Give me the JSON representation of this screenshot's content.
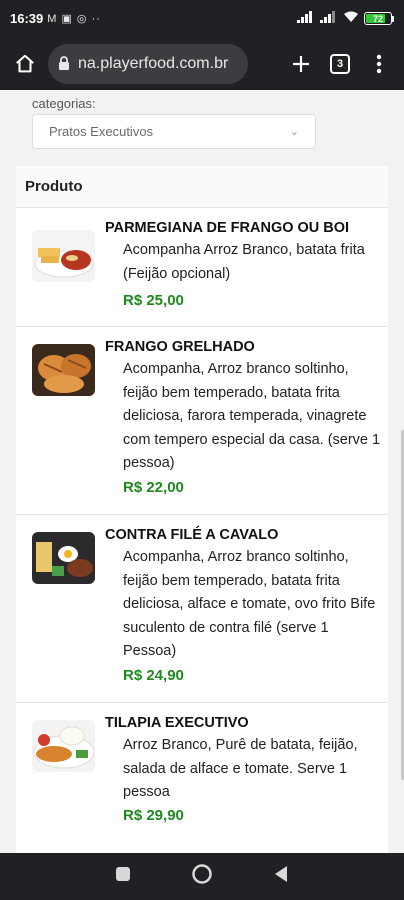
{
  "status_bar": {
    "time": "16:39",
    "left_icons": "M ▣ ◎ ··",
    "battery": "72"
  },
  "browser": {
    "url": "na.playerfood.com.br",
    "tab_count": "3"
  },
  "categories": {
    "label": "categorias:",
    "selected": "Pratos Executivos"
  },
  "products_header": "Produto",
  "products": [
    {
      "name": "PARMEGIANA DE FRANGO OU BOI",
      "description": "Acompanha Arroz Branco, batata frita (Feijão opcional)",
      "price": "R$ 25,00"
    },
    {
      "name": "FRANGO GRELHADO",
      "description": "Acompanha, Arroz branco soltinho, feijão bem temperado, batata frita deliciosa, farora temperada, vinagrete com tempero especial da casa. (serve 1 pessoa)",
      "price": "R$ 22,00"
    },
    {
      "name": "CONTRA FILÉ A CAVALO",
      "description": "Acompanha, Arroz branco soltinho, feijão bem temperado, batata frita deliciosa, alface e tomate, ovo frito Bife suculento de contra filé (serve 1 Pessoa)",
      "price": "R$ 24,90"
    },
    {
      "name": "TILAPIA EXECUTIVO",
      "description": "Arroz Branco, Purê de batata, feijão, salada de alface e tomate. Serve 1 pessoa",
      "price": "R$ 29,90"
    }
  ]
}
